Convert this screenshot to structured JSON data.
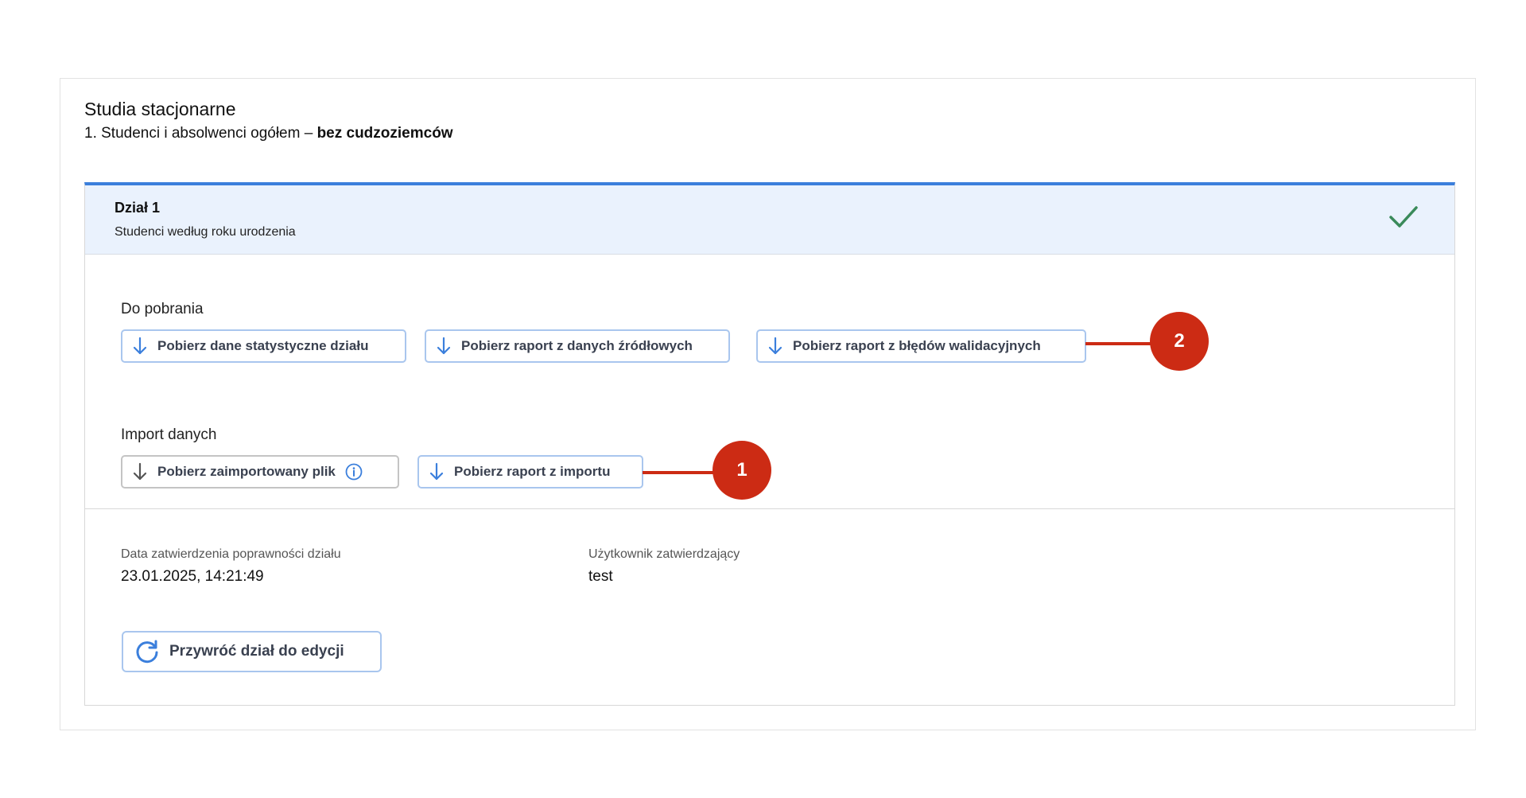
{
  "page": {
    "title": "Studia stacjonarne",
    "subtitle_prefix": "1. Studenci i absolwenci ogółem – ",
    "subtitle_bold": "bez cudzoziemców"
  },
  "section": {
    "title": "Dział 1",
    "description": "Studenci według roku urodzenia",
    "status_icon": "check-icon",
    "status_color": "#3a8a5a"
  },
  "downloads": {
    "label": "Do pobrania",
    "buttons": [
      {
        "label": "Pobierz dane statystyczne działu"
      },
      {
        "label": "Pobierz raport z danych źródłowych"
      },
      {
        "label": "Pobierz raport z błędów walidacyjnych"
      }
    ]
  },
  "import": {
    "label": "Import danych",
    "buttons": [
      {
        "label": "Pobierz zaimportowany plik"
      },
      {
        "label": "Pobierz raport z importu"
      }
    ]
  },
  "approval": {
    "date_label": "Data zatwierdzenia poprawności działu",
    "date_value": "23.01.2025, 14:21:49",
    "user_label": "Użytkownik zatwierdzający",
    "user_value": "test"
  },
  "restore_button": {
    "label": "Przywróć dział do edycji"
  },
  "callouts": [
    {
      "number": "1"
    },
    {
      "number": "2"
    }
  ],
  "colors": {
    "accent": "#3b7fdc",
    "callout": "#cc2b14",
    "header_bg": "#eaf2fd"
  }
}
